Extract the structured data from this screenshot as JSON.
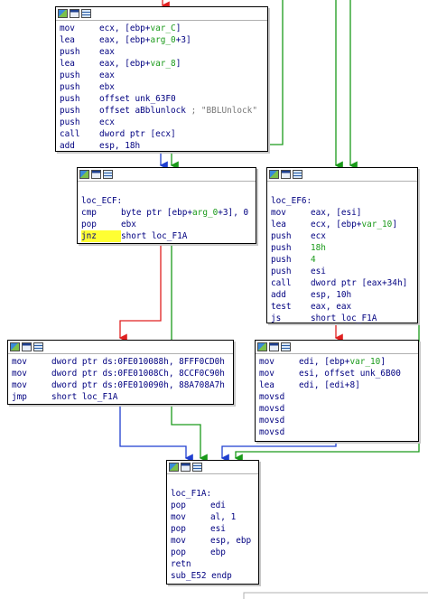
{
  "colors": {
    "edge_green": "#1a9a1a",
    "edge_red": "#e02020",
    "edge_blue": "#1f3fd0",
    "highlight": "#ffff33",
    "mnemonic": "#000080",
    "variable": "#1a9a1a",
    "comment": "#777777"
  },
  "icons": [
    "graph-icon",
    "text-view-icon",
    "list-icon"
  ],
  "blocks": {
    "top": {
      "lines": [
        {
          "mn": "mov",
          "op": "ecx, [ebp+var_C]"
        },
        {
          "mn": "lea",
          "op": "eax, [ebp+arg_0+3]"
        },
        {
          "mn": "push",
          "op": "eax"
        },
        {
          "mn": "lea",
          "op": "eax, [ebp+var_8]"
        },
        {
          "mn": "push",
          "op": "eax"
        },
        {
          "mn": "push",
          "op": "ebx"
        },
        {
          "mn": "push",
          "op": "offset unk_63F0"
        },
        {
          "mn": "push",
          "op": "offset aBblunlock",
          "comment": " ; \"BBLUnlock\""
        },
        {
          "mn": "push",
          "op": "ecx"
        },
        {
          "mn": "call",
          "op": "dword ptr [ecx]"
        },
        {
          "mn": "add",
          "op": "esp, 18h"
        }
      ]
    },
    "ecf": {
      "label": "loc_ECF:",
      "lines": [
        {
          "mn": "cmp",
          "op": "byte ptr [ebp+arg_0+3], 0"
        },
        {
          "mn": "pop",
          "op": "ebx"
        },
        {
          "mn": "jnz",
          "op": "short loc_F1A"
        }
      ]
    },
    "ef6": {
      "label": "loc_EF6:",
      "lines": [
        {
          "mn": "mov",
          "op": "eax, [esi]"
        },
        {
          "mn": "lea",
          "op": "ecx, [ebp+var_10]"
        },
        {
          "mn": "push",
          "op": "ecx"
        },
        {
          "mn": "push",
          "op": "18h"
        },
        {
          "mn": "push",
          "op": "4"
        },
        {
          "mn": "push",
          "op": "esi"
        },
        {
          "mn": "call",
          "op": "dword ptr [eax+34h]"
        },
        {
          "mn": "add",
          "op": "esp, 10h"
        },
        {
          "mn": "test",
          "op": "eax, eax"
        },
        {
          "mn": "js",
          "op": "short loc_F1A"
        }
      ]
    },
    "left": {
      "lines": [
        {
          "mn": "mov",
          "op": "dword ptr ds:0FE010088h, 8FFF0CD0h"
        },
        {
          "mn": "mov",
          "op": "dword ptr ds:0FE01008Ch, 8CCF0C90h"
        },
        {
          "mn": "mov",
          "op": "dword ptr ds:0FE010090h, 88A708A7h"
        },
        {
          "mn": "jmp",
          "op": "short loc_F1A"
        }
      ]
    },
    "right": {
      "lines": [
        {
          "mn": "mov",
          "op": "edi, [ebp+var_10]"
        },
        {
          "mn": "mov",
          "op": "esi, offset unk_6B00"
        },
        {
          "mn": "lea",
          "op": "edi, [edi+8]"
        },
        {
          "mn": "movsd",
          "op": ""
        },
        {
          "mn": "movsd",
          "op": ""
        },
        {
          "mn": "movsd",
          "op": ""
        },
        {
          "mn": "movsd",
          "op": ""
        }
      ]
    },
    "f1a": {
      "label": "loc_F1A:",
      "lines": [
        {
          "mn": "pop",
          "op": "edi"
        },
        {
          "mn": "mov",
          "op": "al, 1"
        },
        {
          "mn": "pop",
          "op": "esi"
        },
        {
          "mn": "mov",
          "op": "esp, ebp"
        },
        {
          "mn": "pop",
          "op": "ebp"
        },
        {
          "mn": "retn",
          "op": ""
        }
      ],
      "endp": "sub_E52 endp"
    }
  }
}
